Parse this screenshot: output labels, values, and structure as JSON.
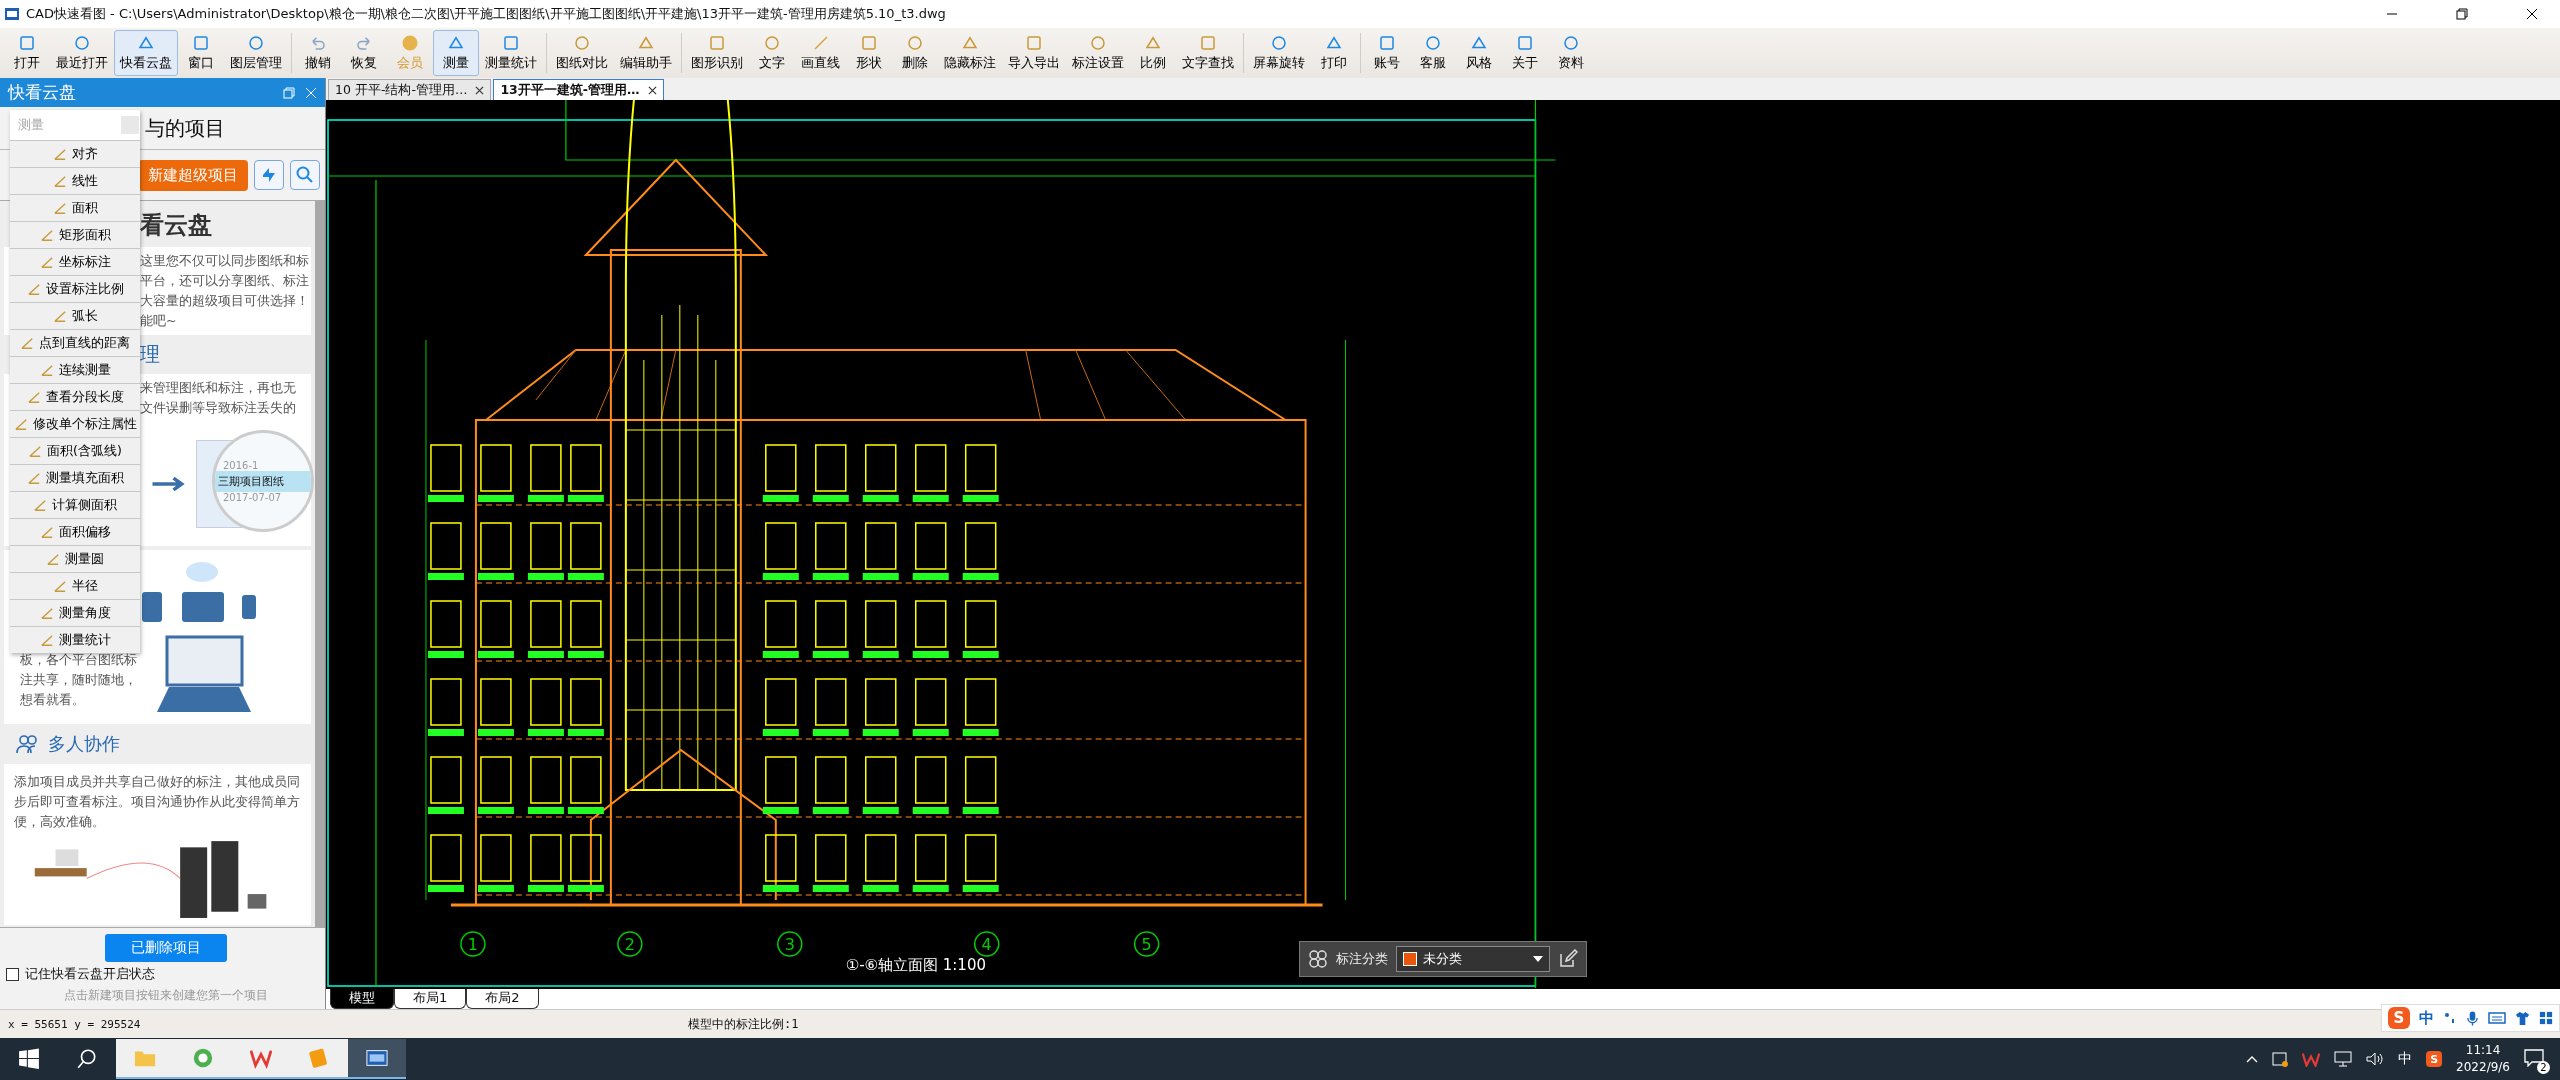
{
  "window": {
    "title": "CAD快速看图 - C:\\Users\\Administrator\\Desktop\\粮仓一期\\粮仓二次图\\开平施工图图纸\\开平施工图图纸\\开平建施\\13开平一建筑-管理用房建筑5.10_t3.dwg"
  },
  "toolbar": [
    {
      "label": "打开",
      "selected": false
    },
    {
      "label": "最近打开",
      "selected": false
    },
    {
      "label": "快看云盘",
      "selected": true
    },
    {
      "label": "窗口",
      "selected": false
    },
    {
      "label": "图层管理",
      "selected": false
    },
    {
      "label": "撤销",
      "selected": false
    },
    {
      "label": "恢复",
      "selected": false
    },
    {
      "label": "会员",
      "selected": false
    },
    {
      "label": "测量",
      "selected": true
    },
    {
      "label": "测量统计",
      "selected": false
    },
    {
      "label": "图纸对比",
      "selected": false
    },
    {
      "label": "编辑助手",
      "selected": false
    },
    {
      "label": "图形识别",
      "selected": false
    },
    {
      "label": "文字",
      "selected": false
    },
    {
      "label": "画直线",
      "selected": false
    },
    {
      "label": "形状",
      "selected": false
    },
    {
      "label": "删除",
      "selected": false
    },
    {
      "label": "隐藏标注",
      "selected": false
    },
    {
      "label": "导入导出",
      "selected": false
    },
    {
      "label": "标注设置",
      "selected": false
    },
    {
      "label": "比例",
      "selected": false
    },
    {
      "label": "文字查找",
      "selected": false
    },
    {
      "label": "屏幕旋转",
      "selected": false
    },
    {
      "label": "打印",
      "selected": false
    },
    {
      "label": "账号",
      "selected": false
    },
    {
      "label": "客服",
      "selected": false
    },
    {
      "label": "风格",
      "selected": false
    },
    {
      "label": "关于",
      "selected": false
    },
    {
      "label": "资料",
      "selected": false
    }
  ],
  "side_panel": {
    "title": "快看云盘",
    "tab_fragment": "与的项目",
    "new_button": "新建超级项目",
    "intro_heading": "看云盘",
    "intro_lines": [
      "这里您不仅可以同步图纸和标",
      "平台，还可以分享图纸、标注",
      "大容量的超级项目可供选择！",
      "能吧~"
    ],
    "manage_heading": "理",
    "manage_lines": [
      "来管理图纸和标注，再也无",
      "文件误删等导致标注丢失的"
    ],
    "illustration_labels": [
      "2016-1",
      "三期项目图纸",
      "2017-07-07"
    ],
    "share_lines": [
      "板，各个平台图纸标",
      "注共享，随时随地，",
      "想看就看。"
    ],
    "collab_heading": "多人协作",
    "collab_text": "添加项目成员并共享自己做好的标注，其他成员同步后即可查看标注。项目沟通协作从此变得简单方便，高效准确。",
    "deleted_button": "已删除项目",
    "remember": {
      "label": "记住快看云盘开启状态",
      "checked": false
    },
    "hint": "点击新建项目按钮来创建您第一个项目"
  },
  "measure_menu": {
    "title": "测量",
    "items": [
      "对齐",
      "线性",
      "面积",
      "矩形面积",
      "坐标标注",
      "设置标注比例",
      "弧长",
      "点到直线的距离",
      "连续测量",
      "查看分段长度",
      "修改单个标注属性",
      "面积(含弧线)",
      "测量填充面积",
      "计算侧面积",
      "面积偏移",
      "测量圆",
      "半径",
      "测量角度",
      "测量统计"
    ]
  },
  "document_tabs": [
    {
      "label": "10 开平-结构-管理用…",
      "selected": false
    },
    {
      "label": "13开平一建筑-管理用…",
      "selected": true
    }
  ],
  "drawing": {
    "axis_labels": [
      "1",
      "2",
      "3",
      "4",
      "5"
    ],
    "title": "①-⑥轴立面图 1:100"
  },
  "annotation_bar": {
    "label": "标注分类",
    "category": "未分类",
    "color": "#e8560c"
  },
  "layout_tabs": [
    {
      "label": "模型",
      "selected": true
    },
    {
      "label": "布局1",
      "selected": false
    },
    {
      "label": "布局2",
      "selected": false
    }
  ],
  "status_bar": {
    "coordinates": "x = 55651 y = 295524",
    "scale": "模型中的标注比例:1"
  },
  "ime_bar": {
    "logo": "S",
    "mode": "中"
  },
  "taskbar": {
    "ime": "中",
    "ime_logo": "S",
    "time": "11:14",
    "date": "2022/9/6",
    "notifications": "2"
  }
}
